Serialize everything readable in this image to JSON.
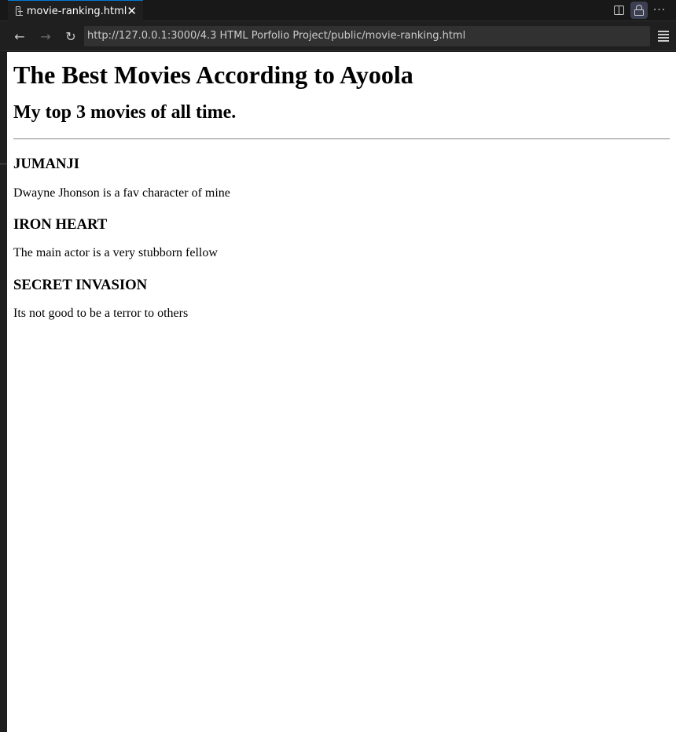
{
  "tab": {
    "title": "movie-ranking.html",
    "close": "✕"
  },
  "tab_actions": {
    "more": "···"
  },
  "nav": {
    "back": "←",
    "forward": "→",
    "reload": "↻",
    "url": "http://127.0.0.1:3000/4.3 HTML Porfolio Project/public/movie-ranking.html"
  },
  "page": {
    "heading": "The Best Movies According to Ayoola",
    "subheading": "My top 3 movies of all time.",
    "movies": [
      {
        "title": "JUMANJI",
        "description": "Dwayne Jhonson is a fav character of mine"
      },
      {
        "title": "IRON HEART",
        "description": "The main actor is a very stubborn fellow"
      },
      {
        "title": "SECRET INVASION",
        "description": "Its not good to be a terror to others"
      }
    ]
  },
  "colors": {
    "chrome_bg": "#1f1f1f",
    "tabbar_bg": "#181818",
    "address_bg": "#313131",
    "accent": "#0078d4",
    "page_bg": "#ffffff"
  }
}
